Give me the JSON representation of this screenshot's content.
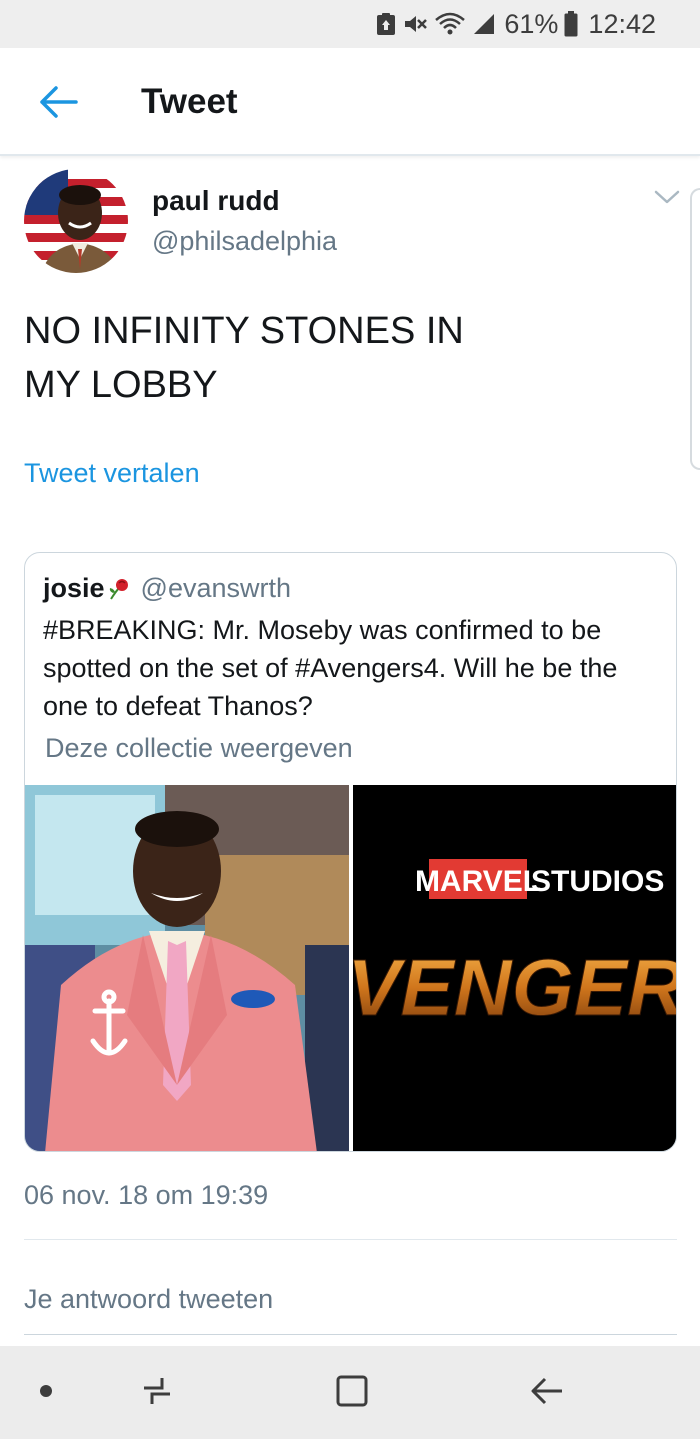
{
  "status_bar": {
    "battery_percent": "61%",
    "time": "12:42",
    "icons": [
      "notification-icon",
      "mute-icon",
      "wifi-icon",
      "signal-icon",
      "battery-icon"
    ]
  },
  "header": {
    "title": "Tweet",
    "back_icon": "arrow-left-icon"
  },
  "tweet": {
    "author_name": "paul rudd",
    "author_handle": "@philsadelphia",
    "text": "NO INFINITY STONES IN\nMY LOBBY",
    "translate_label": "Tweet vertalen",
    "timestamp": "06 nov. 18 om 19:39"
  },
  "quoted_tweet": {
    "author_name": "josie",
    "author_handle": "@evanswrth",
    "text": "#BREAKING: Mr. Moseby was confirmed to be spotted on the set of #Avengers4. Will he be the one to defeat Thanos?",
    "collection_label": "Deze collectie weergeven",
    "media_right": {
      "logo_marvel": "MARVEL",
      "logo_studios": "STUDIOS",
      "title": "VENGERS"
    }
  },
  "reply": {
    "placeholder": "Je antwoord tweeten"
  },
  "colors": {
    "accent": "#1b95e0",
    "secondary_text": "#657786",
    "primary_text": "#14171a",
    "divider": "#e1e8ed"
  }
}
